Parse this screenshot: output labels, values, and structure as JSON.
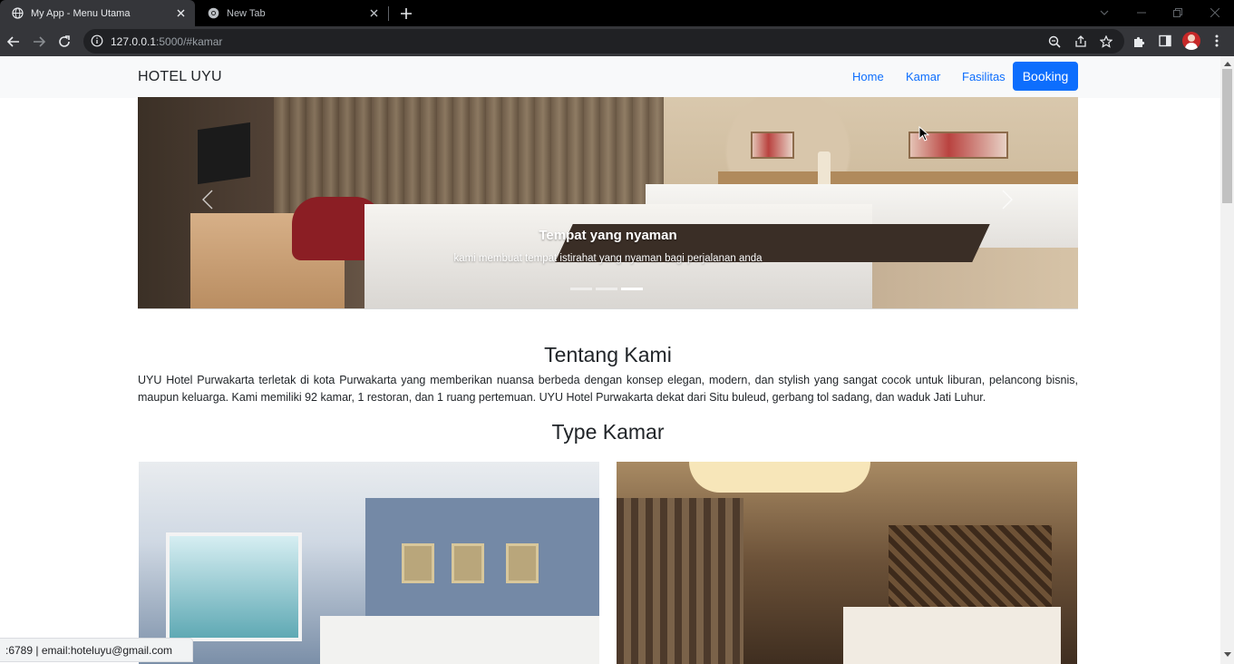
{
  "browser": {
    "tabs": [
      {
        "title": "My App - Menu Utama",
        "active": true,
        "icon": "globe-icon"
      },
      {
        "title": "New Tab",
        "active": false,
        "icon": "chrome-icon"
      }
    ],
    "url_host": "127.0.0.1",
    "url_rest": ":5000/#kamar",
    "toolbar_icons": [
      "back-icon",
      "forward-icon",
      "reload-icon",
      "zoom-icon",
      "share-icon",
      "star-icon",
      "extensions-icon",
      "sidepanel-icon",
      "avatar",
      "menu-icon"
    ]
  },
  "navbar": {
    "brand": "HOTEL UYU",
    "links": [
      "Home",
      "Kamar",
      "Fasilitas"
    ],
    "booking_label": "Booking",
    "accent_color": "#0d6efd"
  },
  "carousel": {
    "caption_title": "Tempat yang nyaman",
    "caption_text": "kami membuat tempat istirahat yang nyaman bagi perjalanan anda",
    "slide_count": 3,
    "active_slide": 3
  },
  "about": {
    "title": "Tentang Kami",
    "text": "UYU Hotel Purwakarta terletak di kota Purwakarta yang memberikan nuansa berbeda dengan konsep elegan, modern, dan stylish yang sangat cocok untuk liburan, pelancong bisnis, maupun keluarga. Kami memiliki 92 kamar, 1 restoran, dan 1 ruang pertemuan. UYU Hotel Purwakarta dekat dari Situ buleud, gerbang tol sadang, dan waduk Jati Luhur."
  },
  "rooms": {
    "title": "Type Kamar"
  },
  "status_bar": {
    "text": ":6789 | email:hoteluyu@gmail.com"
  }
}
